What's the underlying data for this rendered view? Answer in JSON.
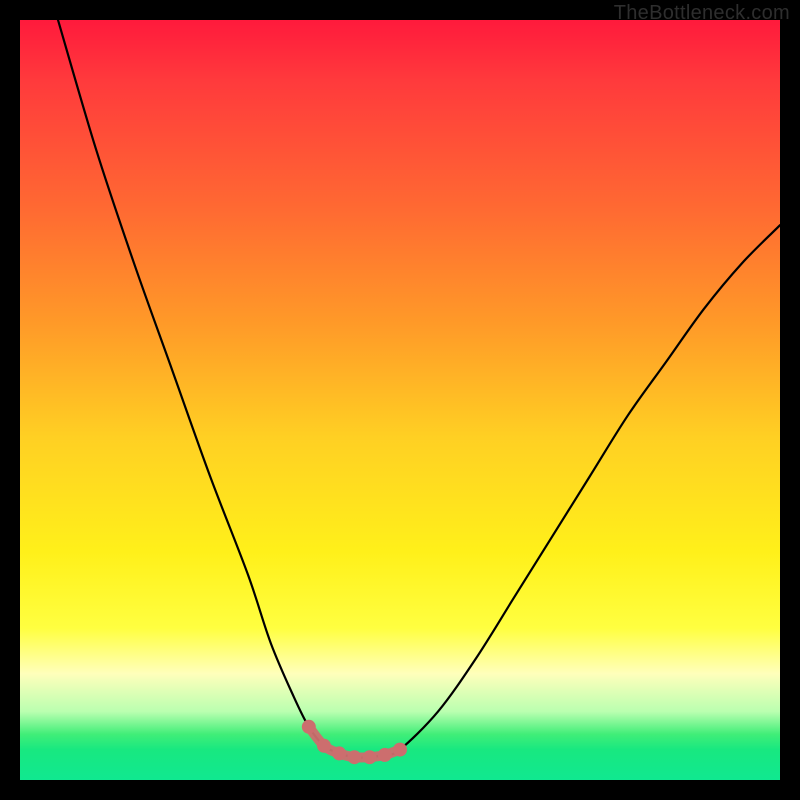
{
  "watermark": "TheBottleneck.com",
  "chart_data": {
    "type": "line",
    "title": "",
    "xlabel": "",
    "ylabel": "",
    "xlim": [
      0,
      100
    ],
    "ylim": [
      0,
      100
    ],
    "series": [
      {
        "name": "bottleneck-curve",
        "x": [
          5,
          10,
          15,
          20,
          25,
          30,
          33,
          36,
          38,
          40,
          42,
          44,
          46,
          48,
          50,
          55,
          60,
          65,
          70,
          75,
          80,
          85,
          90,
          95,
          100
        ],
        "values": [
          100,
          83,
          68,
          54,
          40,
          27,
          18,
          11,
          7,
          4.5,
          3.5,
          3,
          3,
          3.3,
          4,
          9,
          16,
          24,
          32,
          40,
          48,
          55,
          62,
          68,
          73
        ]
      }
    ],
    "markers": {
      "name": "highlighted-range",
      "color": "#cc6e6e",
      "x": [
        38,
        40,
        42,
        44,
        46,
        48,
        50
      ],
      "values": [
        7,
        4.5,
        3.5,
        3,
        3,
        3.3,
        4
      ]
    }
  }
}
